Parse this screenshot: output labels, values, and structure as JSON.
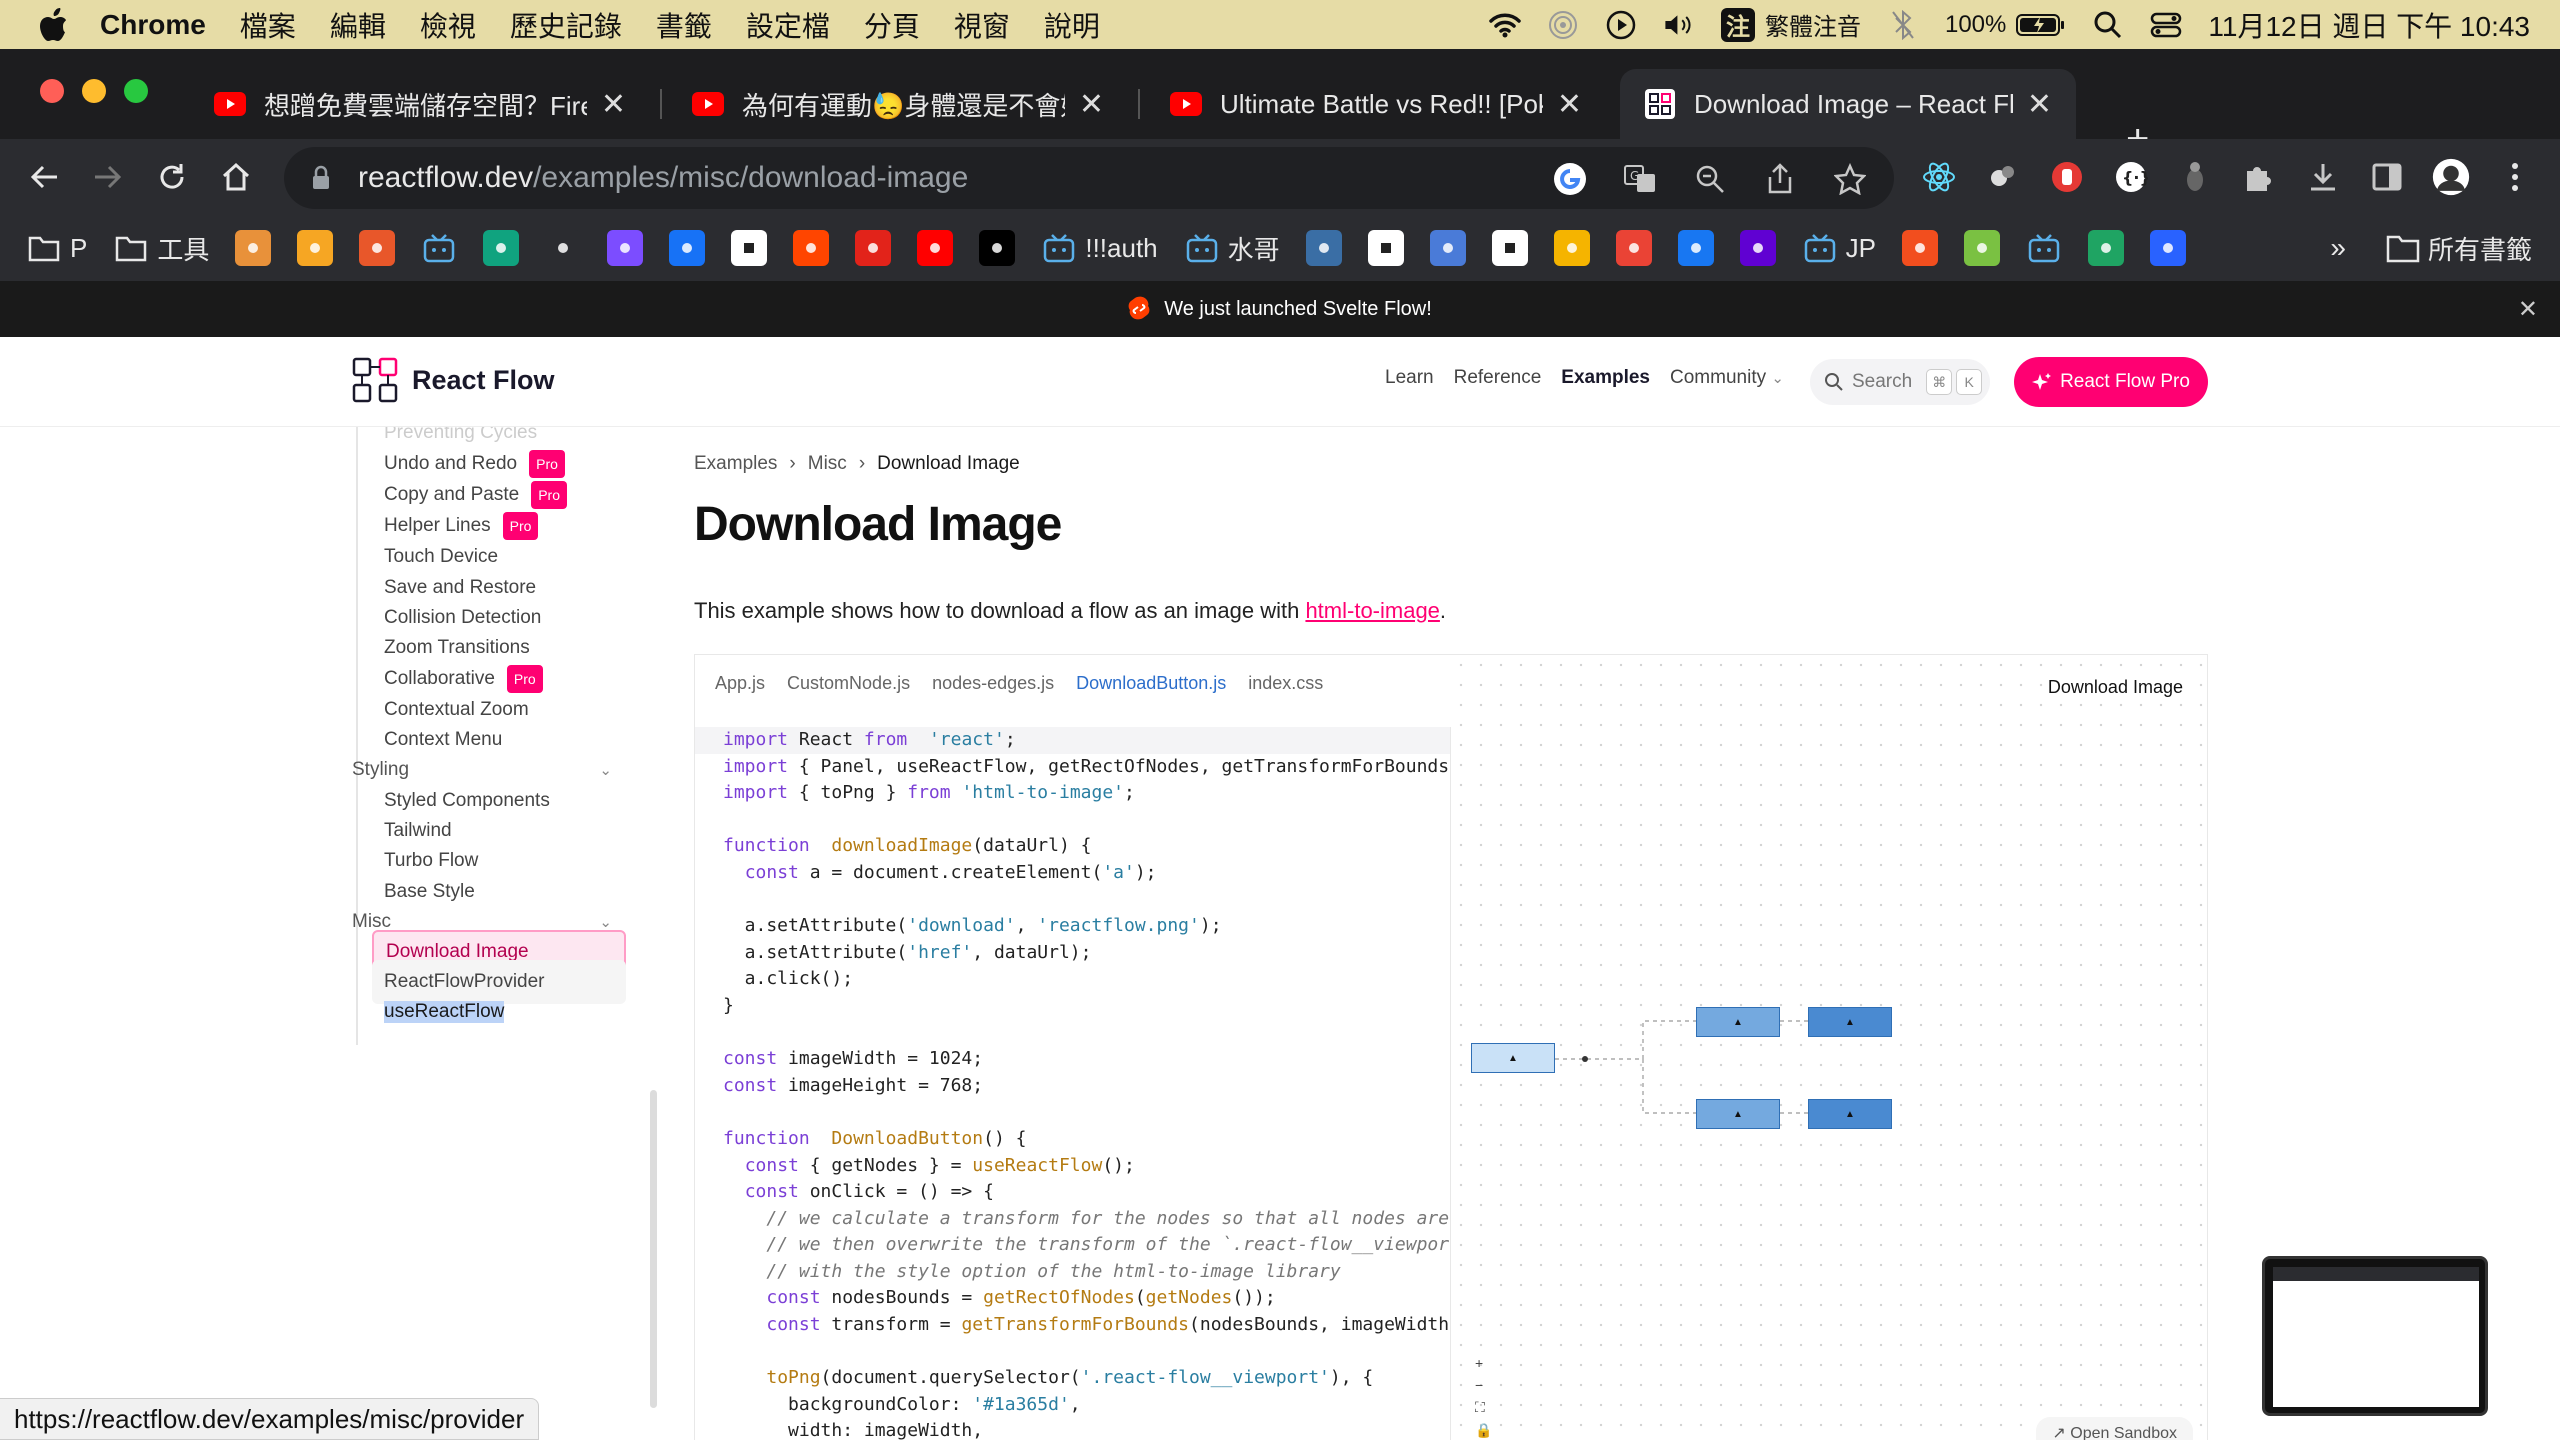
{
  "menubar": {
    "app": "Chrome",
    "items": [
      "檔案",
      "編輯",
      "檢視",
      "歷史記錄",
      "書籤",
      "設定檔",
      "分頁",
      "視窗",
      "說明"
    ],
    "ime_badge": "注",
    "ime_label": "繁體注音",
    "battery": "100%",
    "datetime": "11月12日 週日 下午 10:43"
  },
  "tabs": [
    {
      "title": "想蹭免費雲端儲存空間？Firebase",
      "favicon": "youtube-icon"
    },
    {
      "title": "為何有運動😓身體還是不會好? -",
      "favicon": "youtube-icon"
    },
    {
      "title": "Ultimate Battle vs Red!! [Pokem",
      "favicon": "youtube-icon"
    },
    {
      "title": "Download Image – React Flow",
      "favicon": "reactflow-icon",
      "active": true
    }
  ],
  "toolbar": {
    "url_host": "reactflow.dev",
    "url_path": "/examples/misc/download-image"
  },
  "bookmarks": {
    "items": [
      {
        "label": "P",
        "icon": "folder-icon"
      },
      {
        "label": "工具",
        "icon": "folder-icon"
      },
      {
        "label": "",
        "icon": "box-icon",
        "color": "#e8913a"
      },
      {
        "label": "",
        "icon": "firebase-icon",
        "color": "#f6a623"
      },
      {
        "label": "",
        "icon": "c-icon",
        "color": "#e8572a"
      },
      {
        "label": "",
        "icon": "bilibili-icon",
        "color": "#2b2c30"
      },
      {
        "label": "",
        "icon": "openai-icon",
        "color": "#10a37f"
      },
      {
        "label": "",
        "icon": "github-icon",
        "color": "#2b2c30"
      },
      {
        "label": "",
        "icon": "u-icon",
        "color": "#7c4dff"
      },
      {
        "label": "",
        "icon": "zhihu-icon",
        "color": "#1772f6"
      },
      {
        "label": "",
        "icon": "notion-icon",
        "color": "#fff"
      },
      {
        "label": "",
        "icon": "reddit-icon",
        "color": "#ff4500"
      },
      {
        "label": "",
        "icon": "c-loop-icon",
        "color": "#e2231a"
      },
      {
        "label": "",
        "icon": "youtube-icon",
        "color": "#ff0000"
      },
      {
        "label": "",
        "icon": "medium-icon",
        "color": "#000"
      },
      {
        "label": "!!!auth",
        "icon": "bilibili-icon"
      },
      {
        "label": "水哥",
        "icon": "bilibili-icon"
      },
      {
        "label": "",
        "icon": "feather-icon",
        "color": "#3a6ea5"
      },
      {
        "label": "",
        "icon": "triangle-icon",
        "color": "#fff"
      },
      {
        "label": "",
        "icon": "flag-icon",
        "color": "#4a7bd8"
      },
      {
        "label": "",
        "icon": "codepen-icon",
        "color": "#fff"
      },
      {
        "label": "",
        "icon": "bolt-icon",
        "color": "#f5b400"
      },
      {
        "label": "",
        "icon": "gmail-icon",
        "color": "#ea4335"
      },
      {
        "label": "",
        "icon": "facebook-icon",
        "color": "#1877f2"
      },
      {
        "label": "",
        "icon": "yahoo-mail-icon",
        "color": "#6001d2"
      },
      {
        "label": "JP",
        "icon": "bilibili-icon"
      },
      {
        "label": "",
        "icon": "figma-icon",
        "color": "#f24e1e"
      },
      {
        "label": "",
        "icon": "braces-icon",
        "color": "#7ac142"
      },
      {
        "label": "",
        "icon": "bilibili-icon",
        "color": "#2b2c30"
      },
      {
        "label": "",
        "icon": "drive-icon",
        "color": "#1fa463"
      },
      {
        "label": "",
        "icon": "blue-square-icon",
        "color": "#2962ff"
      }
    ],
    "more": "»",
    "all_bookmarks": "所有書籤"
  },
  "banner": {
    "text": "We just launched Svelte Flow!"
  },
  "site": {
    "logo_text": "React Flow",
    "nav": [
      "Learn",
      "Reference",
      "Examples",
      "Community"
    ],
    "nav_active": "Examples",
    "search_placeholder": "Search",
    "kbd": [
      "⌘",
      "K"
    ],
    "pro_button": "React Flow Pro"
  },
  "sidebar": {
    "faded_item": "Preventing Cycles",
    "pro_label": "Pro",
    "items_a": [
      {
        "label": "Undo and Redo",
        "pro": true
      },
      {
        "label": "Copy and Paste",
        "pro": true
      },
      {
        "label": "Helper Lines",
        "pro": true
      },
      {
        "label": "Touch Device",
        "pro": false
      },
      {
        "label": "Save and Restore",
        "pro": false
      },
      {
        "label": "Collision Detection",
        "pro": false
      },
      {
        "label": "Zoom Transitions",
        "pro": false
      },
      {
        "label": "Collaborative",
        "pro": true
      },
      {
        "label": "Contextual Zoom",
        "pro": false
      },
      {
        "label": "Context Menu",
        "pro": false
      }
    ],
    "group_styling": "Styling",
    "items_styling": [
      "Styled Components",
      "Tailwind",
      "Turbo Flow",
      "Base Style"
    ],
    "group_misc": "Misc",
    "items_misc": [
      "Download Image",
      "ReactFlowProvider",
      "useReactFlow"
    ]
  },
  "main": {
    "breadcrumb": [
      "Examples",
      "Misc",
      "Download Image"
    ],
    "title": "Download Image",
    "intro_before": "This example shows how to download a flow as an image with ",
    "intro_link": "html-to-image",
    "intro_after": ".",
    "code_tabs": [
      "App.js",
      "CustomNode.js",
      "nodes-edges.js",
      "DownloadButton.js",
      "index.css"
    ],
    "code_tab_active": "DownloadButton.js",
    "code_lines": [
      [
        [
          "kw",
          "import"
        ],
        [
          "",
          "React "
        ],
        [
          "kw",
          "from"
        ],
        [
          "",
          "  "
        ],
        [
          "str",
          "'react'"
        ],
        [
          "",
          ";"
        ]
      ],
      [
        [
          "kw",
          "import"
        ],
        [
          "",
          "{ Panel, useReactFlow, getRectOfNodes, getTransformForBounds }"
        ]
      ],
      [
        [
          "kw",
          "import"
        ],
        [
          "",
          "{ toPng } "
        ],
        [
          "kw",
          "from"
        ],
        [
          "",
          ""
        ],
        [
          "str",
          "'html-to-image'"
        ],
        [
          "",
          ";"
        ]
      ],
      [
        [
          "",
          ""
        ]
      ],
      [
        [
          "kw",
          "function "
        ],
        [
          "fn",
          "downloadImage"
        ],
        [
          "",
          "(dataUrl) {"
        ]
      ],
      [
        [
          "",
          "  "
        ],
        [
          "kw",
          "const"
        ],
        [
          "",
          " a = document.createElement("
        ],
        [
          "str",
          "'a'"
        ],
        [
          "",
          ");"
        ]
      ],
      [
        [
          "",
          ""
        ]
      ],
      [
        [
          "",
          "  a.setAttribute("
        ],
        [
          "str",
          "'download'"
        ],
        [
          "",
          ", "
        ],
        [
          "str",
          "'reactflow.png'"
        ],
        [
          "",
          ");"
        ]
      ],
      [
        [
          "",
          "  a.setAttribute("
        ],
        [
          "str",
          "'href'"
        ],
        [
          "",
          ", dataUrl);"
        ]
      ],
      [
        [
          "",
          "  a.click();"
        ]
      ],
      [
        [
          "",
          "}"
        ]
      ],
      [
        [
          "",
          ""
        ]
      ],
      [
        [
          "kw",
          "const"
        ],
        [
          "",
          " imageWidth = 1024;"
        ]
      ],
      [
        [
          "kw",
          "const"
        ],
        [
          "",
          " imageHeight = 768;"
        ]
      ],
      [
        [
          "",
          ""
        ]
      ],
      [
        [
          "kw",
          "function "
        ],
        [
          "fn",
          "DownloadButton"
        ],
        [
          "",
          "() {"
        ]
      ],
      [
        [
          "",
          "  "
        ],
        [
          "kw",
          "const"
        ],
        [
          "",
          " { getNodes } = "
        ],
        [
          "fn",
          "useReactFlow"
        ],
        [
          "",
          "();"
        ]
      ],
      [
        [
          "",
          "  "
        ],
        [
          "kw",
          "const"
        ],
        [
          "",
          " onClick = () => {"
        ]
      ],
      [
        [
          "",
          "    "
        ],
        [
          "cm",
          "// we calculate a transform for the nodes so that all nodes are vi"
        ]
      ],
      [
        [
          "",
          "    "
        ],
        [
          "cm",
          "// we then overwrite the transform of the `.react-flow__viewport`"
        ]
      ],
      [
        [
          "",
          "    "
        ],
        [
          "cm",
          "// with the style option of the html-to-image library"
        ]
      ],
      [
        [
          "",
          "    "
        ],
        [
          "kw",
          "const"
        ],
        [
          "",
          " nodesBounds = "
        ],
        [
          "fn",
          "getRectOfNodes"
        ],
        [
          "",
          "("
        ],
        [
          "fn",
          "getNodes"
        ],
        [
          "",
          "());"
        ]
      ],
      [
        [
          "",
          "    "
        ],
        [
          "kw",
          "const"
        ],
        [
          "",
          " transform = "
        ],
        [
          "fn",
          "getTransformForBounds"
        ],
        [
          "",
          "(nodesBounds, imageWidth, i"
        ]
      ],
      [
        [
          "",
          ""
        ]
      ],
      [
        [
          "",
          "    "
        ],
        [
          "fn",
          "toPng"
        ],
        [
          "",
          "(document.querySelector("
        ],
        [
          "str",
          "'.react-flow__viewport'"
        ],
        [
          "",
          "), {"
        ]
      ],
      [
        [
          "",
          "      backgroundColor: "
        ],
        [
          "str",
          "'#1a365d'"
        ],
        [
          "",
          ","
        ]
      ],
      [
        [
          "",
          "      width: imageWidth,"
        ]
      ]
    ],
    "canvas_button": "Download Image",
    "node_label": "▲",
    "controls": [
      "+",
      "−",
      "⛶",
      "🔒"
    ],
    "sandbox": "Open Sandbox"
  },
  "status_url": "https://reactflow.dev/examples/misc/provider"
}
